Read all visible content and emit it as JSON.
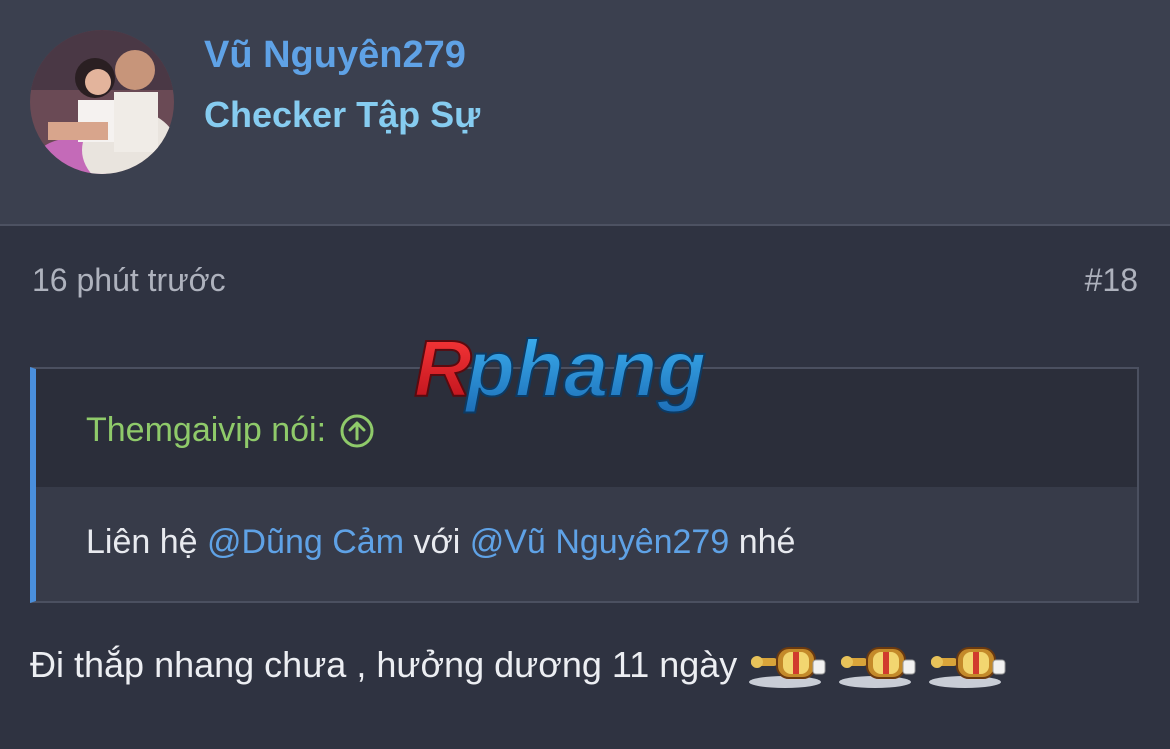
{
  "post": {
    "author": {
      "username": "Vũ Nguyên279",
      "title": "Checker Tập Sự"
    },
    "time": "16 phút trước",
    "number": "#18",
    "quote": {
      "author": "Themgaivip nói:",
      "text_before": "Liên hệ ",
      "mention1": "@Dũng Cảm",
      "text_middle": " với ",
      "mention2": "@Vũ Nguyên279",
      "text_after": " nhé"
    },
    "message": "Đi thắp nhang chưa , hưởng dương 11 ngày",
    "smileys": [
      "incense-smiley",
      "incense-smiley",
      "incense-smiley"
    ]
  },
  "watermark": {
    "text": "Rphang"
  },
  "colors": {
    "background": "#2f3341",
    "header": "#3b404f",
    "username": "#5fa2e6",
    "user_title": "#86ccf0",
    "quote_author": "#8fca6a",
    "quote_border": "#4a8fdc",
    "mention": "#5fa2e6"
  }
}
